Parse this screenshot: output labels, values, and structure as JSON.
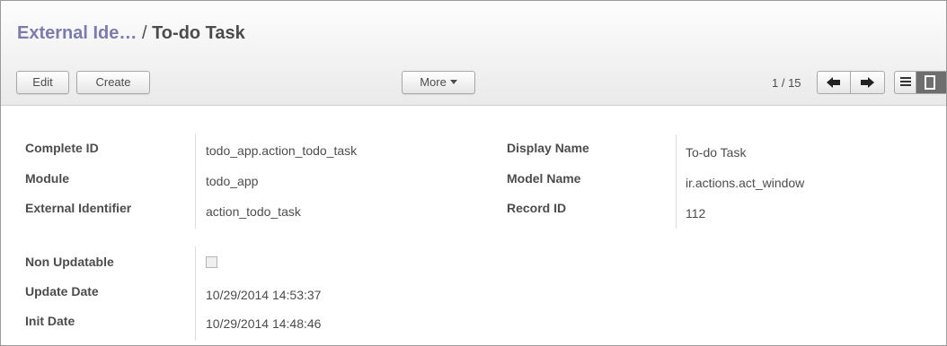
{
  "breadcrumb": {
    "parent": "External Ide…",
    "separator": "/",
    "current": "To-do Task"
  },
  "toolbar": {
    "edit_label": "Edit",
    "create_label": "Create",
    "more_label": "More",
    "pager_value": "1 / 15"
  },
  "icons": {
    "caret": "caret-down-icon",
    "prev": "arrow-left-icon",
    "next": "arrow-right-icon",
    "list_view": "list-view-icon",
    "form_view": "form-view-icon"
  },
  "form": {
    "left": [
      {
        "label": "Complete ID",
        "value": "todo_app.action_todo_task"
      },
      {
        "label": "Module",
        "value": "todo_app"
      },
      {
        "label": "External Identifier",
        "value": "action_todo_task"
      }
    ],
    "right": [
      {
        "label": "Display Name",
        "value": "To-do Task"
      },
      {
        "label": "Model Name",
        "value": "ir.actions.act_window"
      },
      {
        "label": "Record ID",
        "value": "112"
      }
    ],
    "lower": [
      {
        "label": "Non Updatable",
        "value": ""
      },
      {
        "label": "Update Date",
        "value": "10/29/2014 14:53:37"
      },
      {
        "label": "Init Date",
        "value": "10/29/2014 14:48:46"
      }
    ],
    "non_updatable_checked": false
  },
  "colors": {
    "breadcrumb_link": "#7c7bad",
    "text": "#4c4c4c",
    "active_view": "#6e6e6e"
  }
}
